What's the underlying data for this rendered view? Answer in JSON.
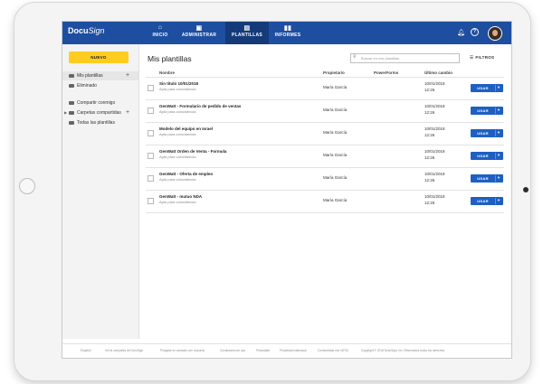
{
  "nav": {
    "logo_a": "Docu",
    "logo_b": "Sign",
    "tabs": [
      {
        "label": "INICIO",
        "icon": "home-icon"
      },
      {
        "label": "ADMINISTRAR",
        "icon": "admin-icon"
      },
      {
        "label": "PLANTILLAS",
        "icon": "templates-icon"
      },
      {
        "label": "INFORMES",
        "icon": "reports-icon"
      }
    ],
    "active_tab": "PLANTILLAS"
  },
  "sidebar": {
    "new_label": "NUEVO",
    "items": [
      {
        "label": "Mis plantillas"
      },
      {
        "label": "Eliminado"
      },
      {
        "label": "Compartir conmigo"
      },
      {
        "label": "Carpetas compartidas"
      },
      {
        "label": "Todas las plantillas"
      }
    ]
  },
  "main": {
    "title": "Mis plantillas",
    "search_placeholder": "Buscar en mis plantillas",
    "filters_label": "FILTROS",
    "columns": [
      "Nombre",
      "Propietario",
      "PowerForms",
      "Último cambio"
    ],
    "use_label": "USAR",
    "rows": [
      {
        "name": "Sin título 10/01/2018",
        "subtitle": "Apta para coincidencia",
        "owner": "María García",
        "date": "10/01/2018",
        "time": "12:26"
      },
      {
        "name": "GenWatt - Formulario de pedido de ventas",
        "subtitle": "Apta para coincidencia",
        "owner": "María García",
        "date": "10/01/2018",
        "time": "12:26"
      },
      {
        "name": "Modelo del equipo en Israel",
        "subtitle": "Apta para coincidencia",
        "owner": "María García",
        "date": "10/01/2018",
        "time": "12:26"
      },
      {
        "name": "GenWatt Orden de Venta - Formula",
        "subtitle": "Apta para coincidencia",
        "owner": "María García",
        "date": "10/01/2018",
        "time": "12:26"
      },
      {
        "name": "GenWatt - Oferta de empleo",
        "subtitle": "Apta para coincidencia",
        "owner": "María García",
        "date": "10/01/2018",
        "time": "12:26"
      },
      {
        "name": "GenWatt - mutuo NDA",
        "subtitle": "Apta para coincidencia",
        "owner": "María García",
        "date": "10/01/2018",
        "time": "12:26"
      }
    ]
  },
  "footer": {
    "links": [
      "Español",
      "Ver la compañía de DocuSign",
      "Póngase en contacto con nosotros",
      "Condiciones de uso",
      "Privacidad",
      "Propiedad intelectual",
      "Conformidad con xDTM",
      "Copyright © 2018 DocuSign, Inc. Reservados todos los derechos."
    ]
  },
  "colors": {
    "nav": "#1e4ea0",
    "accent_button": "#1e5fc4",
    "new_button": "#ffcc22"
  }
}
